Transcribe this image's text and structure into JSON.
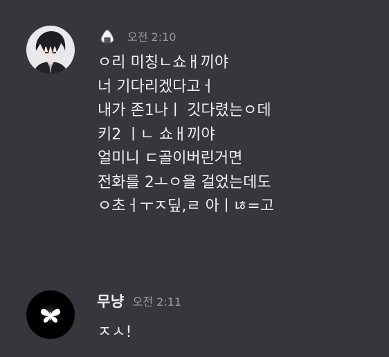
{
  "messages": [
    {
      "username": "",
      "role_icon": "onigiri-icon",
      "timestamp": "오전 2:10",
      "lines": [
        "ㅇ리 미칭ㄴ쇼ㅐ끼야",
        "너 기다리겠다고ㅓ",
        "내가 존1나ㅣ 깃다렸는ㅇ데",
        "키2 ㅣㄴ 쇼ㅐ끼야",
        "얼미니 ㄷ골이버린거면",
        "전화를 2ㅗㅇ을 걸었는데도",
        "ㅇ초ㅓㅜㅈ딮,ㄹ 아ㅣㄶ=고"
      ]
    },
    {
      "username": "무냥",
      "timestamp": "오전 2:11",
      "lines": [
        "ㅈㅅ!"
      ]
    }
  ],
  "colors": {
    "background": "#36373d",
    "text": "#eef0f3",
    "timestamp": "#9a9ca3"
  }
}
